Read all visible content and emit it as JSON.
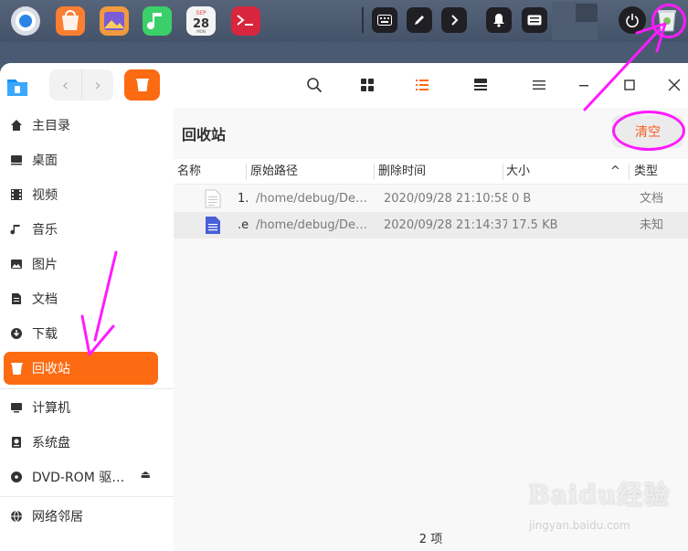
{
  "dock": {
    "apps": [
      {
        "name": "chrome-icon"
      },
      {
        "name": "app-store-icon"
      },
      {
        "name": "image-viewer-icon"
      },
      {
        "name": "music-icon"
      },
      {
        "name": "calendar-icon",
        "month": "SEP",
        "day": "28",
        "weekday": "MON"
      },
      {
        "name": "terminal-icon"
      }
    ],
    "tray": [
      "keyboard-icon",
      "pen-icon",
      "chevron-right-icon",
      "bell-icon",
      "input-method-icon",
      "power-icon",
      "trash-tray-icon"
    ]
  },
  "window": {
    "toolbar": {
      "back": "‹",
      "forward": "›",
      "icons": [
        "search-icon",
        "grid-view-icon",
        "list-view-icon",
        "detail-view-icon",
        "menu-icon",
        "minimize-icon",
        "maximize-icon",
        "close-icon"
      ]
    },
    "sidebar": {
      "items": [
        {
          "label": "主目录",
          "icon": "home-icon"
        },
        {
          "label": "桌面",
          "icon": "desktop-icon"
        },
        {
          "label": "视频",
          "icon": "video-icon"
        },
        {
          "label": "音乐",
          "icon": "music-note-icon"
        },
        {
          "label": "图片",
          "icon": "picture-icon"
        },
        {
          "label": "文档",
          "icon": "document-icon"
        },
        {
          "label": "下载",
          "icon": "download-icon"
        },
        {
          "label": "回收站",
          "icon": "trash-icon",
          "active": true
        },
        {
          "label": "计算机",
          "icon": "computer-icon"
        },
        {
          "label": "系统盘",
          "icon": "disk-icon"
        },
        {
          "label": "DVD-ROM 驱…",
          "icon": "dvd-icon",
          "eject": "⏏"
        },
        {
          "label": "网络邻居",
          "icon": "network-icon"
        }
      ]
    },
    "main": {
      "title": "回收站",
      "empty_button": "清空",
      "columns": [
        "名称",
        "原始路径",
        "删除时间",
        "大小",
        "类型"
      ],
      "sort_indicator": "^",
      "rows": [
        {
          "name": "1.",
          "path": "/home/debug/De…",
          "time": "2020/09/28 21:10:58",
          "size": "0 B",
          "type": "文档",
          "icon": "text-file-icon"
        },
        {
          "name": ".e",
          "path": "/home/debug/De…",
          "time": "2020/09/28 21:14:37",
          "size": "17.5 KB",
          "type": "未知",
          "icon": "blue-file-icon"
        }
      ],
      "status": "2 项"
    }
  },
  "watermark": {
    "big": "Baidu经验",
    "small": "jingyan.baidu.com"
  },
  "colors": {
    "accent": "#fc6a12",
    "annotation": "#ff1bff",
    "danger_text": "#fc5a1e"
  }
}
